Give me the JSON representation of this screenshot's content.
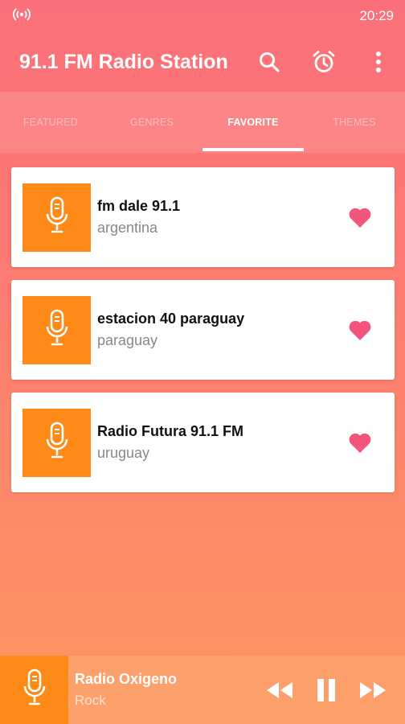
{
  "status_bar": {
    "time": "20:29",
    "left_icon": "radio-broadcast-icon"
  },
  "app_bar": {
    "title": "91.1 FM Radio Station",
    "actions": [
      "search-icon",
      "alarm-clock-icon",
      "more-vert-icon"
    ]
  },
  "tabs": [
    {
      "label": "FEATURED",
      "active": false
    },
    {
      "label": "GENRES",
      "active": false
    },
    {
      "label": "FAVORITE",
      "active": true
    },
    {
      "label": "THEMES",
      "active": false
    }
  ],
  "favorites": [
    {
      "name": "fm dale 91.1",
      "country": "argentina",
      "favorited": true
    },
    {
      "name": "estacion 40 paraguay",
      "country": "paraguay",
      "favorited": true
    },
    {
      "name": "Radio Futura 91.1 FM",
      "country": "uruguay",
      "favorited": true
    }
  ],
  "player": {
    "title": "Radio Oxigeno",
    "subtitle": "Rock",
    "controls": [
      "rewind-icon",
      "pause-icon",
      "fast-forward-icon"
    ]
  },
  "colors": {
    "accent_orange": "#fd8a17",
    "heart_pink": "#f2547e",
    "gradient_top": "#fb6f7a",
    "gradient_bottom": "#fd9760"
  }
}
